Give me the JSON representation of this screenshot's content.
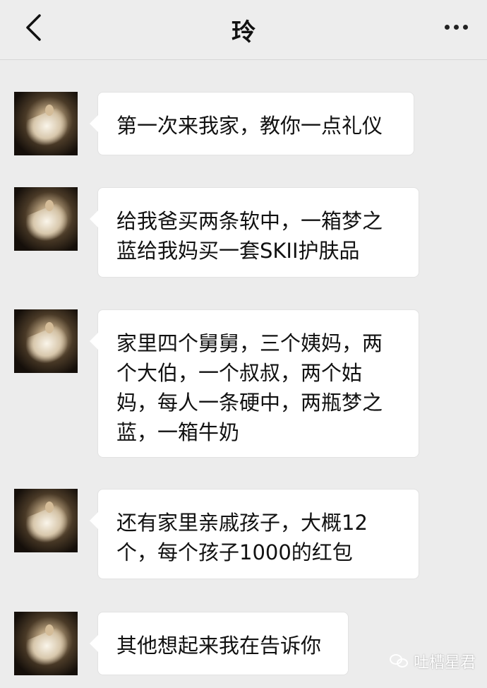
{
  "header": {
    "title": "玲",
    "back_icon": "chevron-left-icon",
    "more_icon": "more-horizontal-icon"
  },
  "messages": [
    {
      "text": "第一次来我家，教你一点礼仪"
    },
    {
      "text": "给我爸买两条软中，一箱梦之蓝给我妈买一套SKII护肤品"
    },
    {
      "text": "家里四个舅舅，三个姨妈，两个大伯，一个叔叔，两个姑妈，每人一条硬中，两瓶梦之蓝，一箱牛奶"
    },
    {
      "text": "还有家里亲戚孩子，大概12个，每个孩子1000的红包"
    },
    {
      "text": "其他想起来我在告诉你"
    }
  ],
  "watermark": {
    "text": "吐槽星君",
    "icon": "wechat-icon"
  },
  "colors": {
    "background": "#ececec",
    "bubble": "#ffffff",
    "text": "#111111"
  }
}
